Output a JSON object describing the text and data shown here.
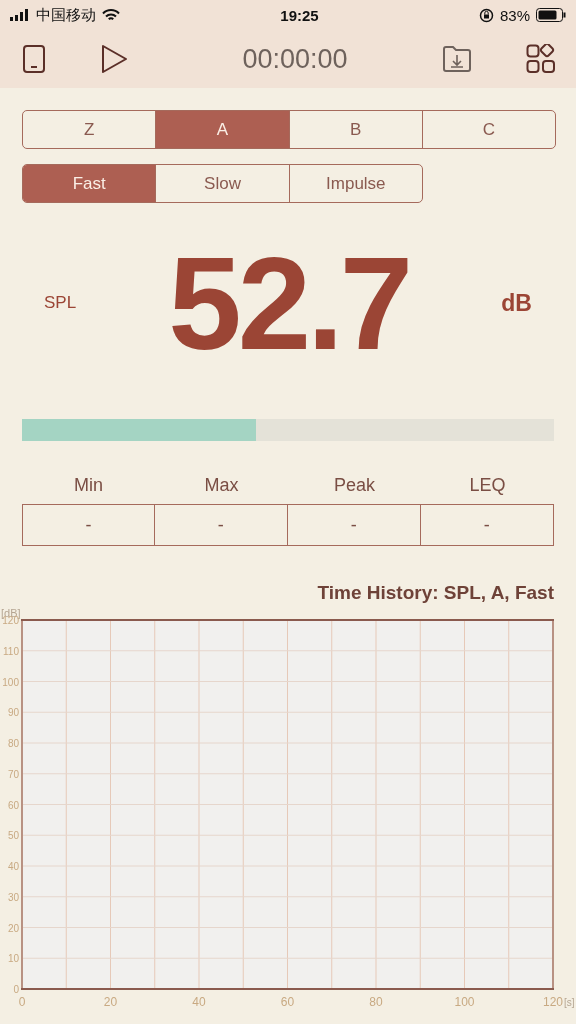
{
  "status_bar": {
    "carrier": "中国移动",
    "time": "19:25",
    "battery": "83%"
  },
  "toolbar": {
    "timer": "00:00:00"
  },
  "weighting": [
    {
      "label": "Z",
      "selected": false
    },
    {
      "label": "A",
      "selected": true
    },
    {
      "label": "B",
      "selected": false
    },
    {
      "label": "C",
      "selected": false
    }
  ],
  "response": [
    {
      "label": "Fast",
      "selected": true
    },
    {
      "label": "Slow",
      "selected": false
    },
    {
      "label": "Impulse",
      "selected": false
    }
  ],
  "reading": {
    "label": "SPL",
    "value": "52.7",
    "unit": "dB"
  },
  "meter": {
    "level": 0.44
  },
  "stats": [
    {
      "label": "Min",
      "value": "-"
    },
    {
      "label": "Max",
      "value": "-"
    },
    {
      "label": "Peak",
      "value": "-"
    },
    {
      "label": "LEQ",
      "value": "-"
    }
  ],
  "history": {
    "chart_data": {
      "type": "line",
      "grid": true,
      "title": "Time History: SPL, A, Fast",
      "xlabel": "[s]",
      "ylabel": "[dB]",
      "xlim": [
        0,
        120
      ],
      "ylim": [
        0,
        120
      ],
      "xticks": [
        0,
        20,
        40,
        60,
        80,
        100,
        120
      ],
      "yticks": [
        0,
        10,
        20,
        30,
        40,
        50,
        60,
        70,
        80,
        90,
        100,
        110,
        120
      ]
    }
  }
}
